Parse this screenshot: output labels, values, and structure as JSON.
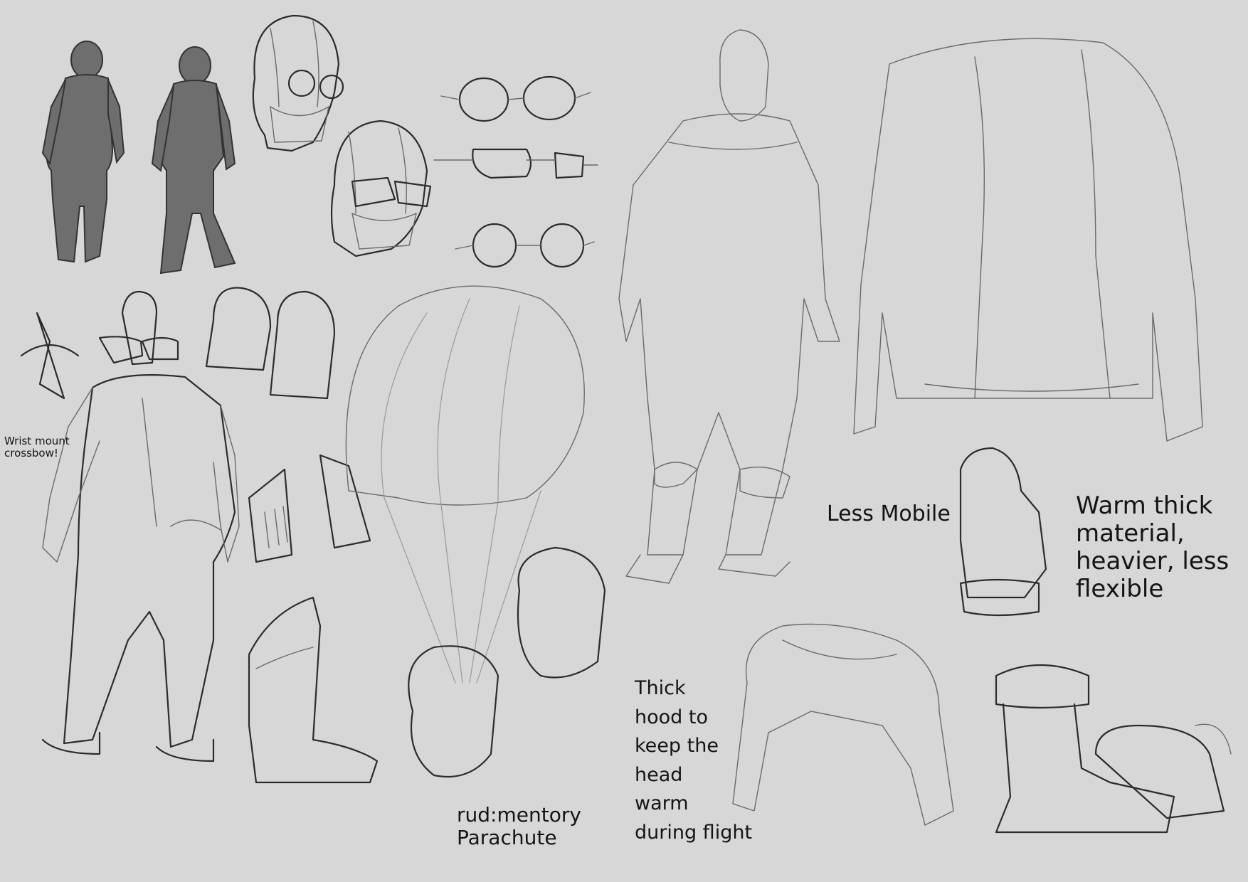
{
  "notes": {
    "wrist_crossbow": "Wrist mount\ncrossbow!",
    "parachute": "rud:mentory\nParachute",
    "less_mobile": "Less Mobile",
    "warm_material": "Warm thick\nmaterial,\nheavier, less\nflexible",
    "thick_hood": "Thick\nhood to\nkeep the\nhead\nwarm\nduring flight"
  }
}
